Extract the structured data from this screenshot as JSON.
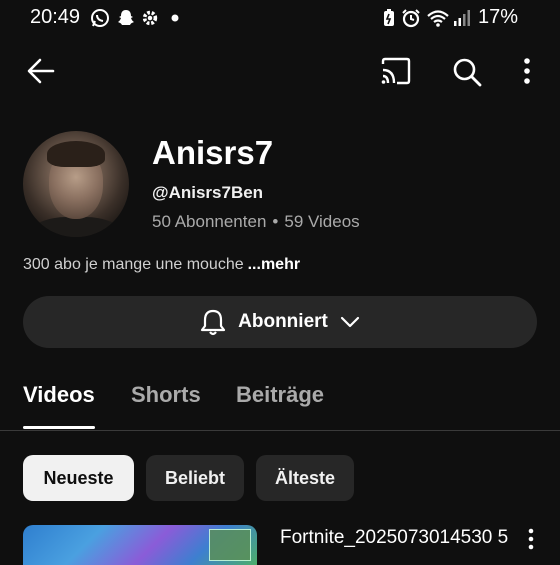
{
  "status_bar": {
    "time": "20:49",
    "battery_percent": "17%",
    "left_icons": [
      "whatsapp-icon",
      "snapchat-icon",
      "settings-icon",
      "dot-icon"
    ],
    "right_icons": [
      "battery-saver-icon",
      "alarm-icon",
      "wifi-icon",
      "signal-icon"
    ]
  },
  "app_bar": {
    "icons": [
      "back-icon",
      "cast-icon",
      "search-icon",
      "more-vert-icon"
    ]
  },
  "channel": {
    "name": "Anisrs7",
    "handle": "@Anisrs7Ben",
    "subscribers": "50 Abonnenten",
    "separator": "•",
    "videos": "59 Videos",
    "description": "300 abo je mange une mouche",
    "more_label": "...mehr"
  },
  "subscribe_button": {
    "label": "Abonniert",
    "icon": "bell-icon"
  },
  "tabs": [
    {
      "label": "Videos",
      "active": true
    },
    {
      "label": "Shorts",
      "active": false
    },
    {
      "label": "Beiträge",
      "active": false
    }
  ],
  "filter_chips": [
    {
      "label": "Neueste",
      "selected": true
    },
    {
      "label": "Beliebt",
      "selected": false
    },
    {
      "label": "Älteste",
      "selected": false
    }
  ],
  "video": {
    "title": "Fortnite_2025073014530 5"
  },
  "colors": {
    "background": "#0f0f0f",
    "surface": "#272727",
    "text_primary": "#f1f1f1",
    "text_secondary": "#aaaaaa"
  }
}
